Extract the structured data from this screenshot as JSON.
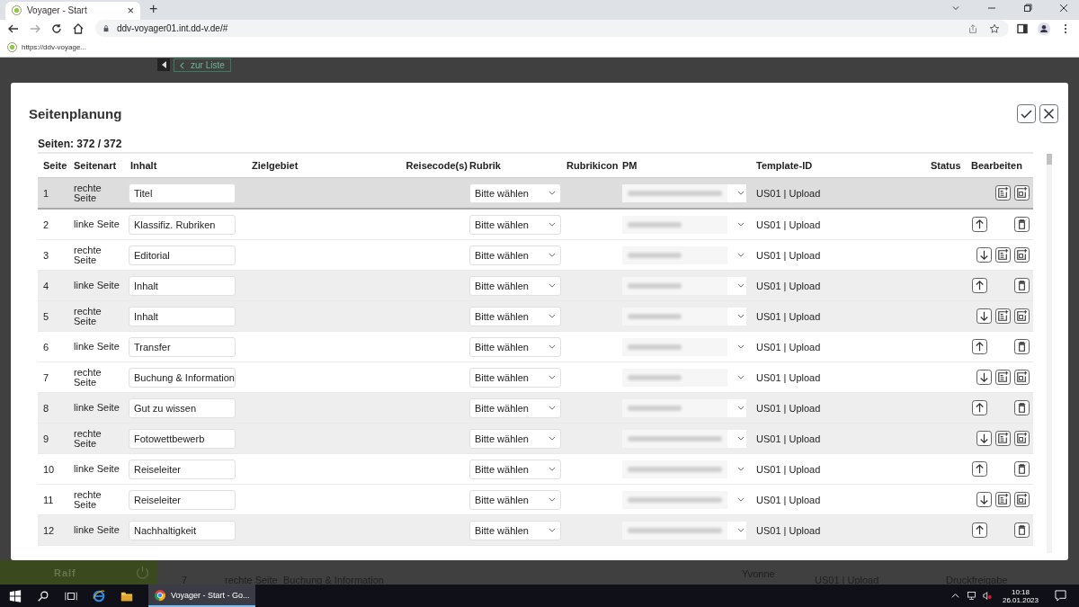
{
  "browser": {
    "tab_title": "Voyager - Start",
    "tab_close": "×",
    "new_tab": "+",
    "url": "ddv-voyager01.int.dd-v.de/#",
    "bookmark": "https://ddv-voyage..."
  },
  "background": {
    "back_button": "zur Liste",
    "user": "Ralf",
    "row": {
      "seite": "7",
      "seitenart": "rechte Seite",
      "inhalt": "Buchung & Information",
      "pm": "Yvonne",
      "template": "US01 | Upload",
      "status": "Druckfreigabe"
    }
  },
  "dialog": {
    "title": "Seitenplanung",
    "count": "Seiten: 372 / 372",
    "columns": [
      "Seite",
      "Seitenart",
      "Inhalt",
      "Zielgebiet",
      "Reisecode(s)",
      "Rubrik",
      "Rubrikicon",
      "PM",
      "Template-ID",
      "Status",
      "Bearbeiten"
    ],
    "rows": [
      {
        "seite": "1",
        "seitenart": "rechte Seite",
        "inhalt": "Titel",
        "rubrik": "Bitte wählen",
        "template": "US01 | Upload",
        "selected": true,
        "shaded": false,
        "actions": [
          {
            "kind": "add"
          },
          {
            "kind": "add-image"
          }
        ]
      },
      {
        "seite": "2",
        "seitenart": "linke Seite",
        "inhalt": "Klassifiz. Rubriken",
        "rubrik": "Bitte wählen",
        "template": "US01 | Upload",
        "selected": false,
        "shaded": false,
        "actions": [
          {
            "kind": "up"
          },
          {
            "kind": "delete"
          }
        ]
      },
      {
        "seite": "3",
        "seitenart": "rechte Seite",
        "inhalt": "Editorial",
        "rubrik": "Bitte wählen",
        "template": "US01 | Upload",
        "selected": false,
        "shaded": false,
        "actions": [
          {
            "kind": "down"
          },
          {
            "kind": "add"
          },
          {
            "kind": "add-image"
          }
        ]
      },
      {
        "seite": "4",
        "seitenart": "linke Seite",
        "inhalt": "Inhalt",
        "rubrik": "Bitte wählen",
        "template": "US01 | Upload",
        "selected": false,
        "shaded": true,
        "actions": [
          {
            "kind": "up"
          },
          {
            "kind": "delete"
          }
        ]
      },
      {
        "seite": "5",
        "seitenart": "rechte Seite",
        "inhalt": "Inhalt",
        "rubrik": "Bitte wählen",
        "template": "US01 | Upload",
        "selected": false,
        "shaded": true,
        "actions": [
          {
            "kind": "down"
          },
          {
            "kind": "add"
          },
          {
            "kind": "add-image"
          }
        ]
      },
      {
        "seite": "6",
        "seitenart": "linke Seite",
        "inhalt": "Transfer",
        "rubrik": "Bitte wählen",
        "template": "US01 | Upload",
        "selected": false,
        "shaded": false,
        "actions": [
          {
            "kind": "up"
          },
          {
            "kind": "delete"
          }
        ]
      },
      {
        "seite": "7",
        "seitenart": "rechte Seite",
        "inhalt": "Buchung & Information",
        "rubrik": "Bitte wählen",
        "template": "US01 | Upload",
        "selected": false,
        "shaded": false,
        "actions": [
          {
            "kind": "down"
          },
          {
            "kind": "add"
          },
          {
            "kind": "add-image"
          }
        ]
      },
      {
        "seite": "8",
        "seitenart": "linke Seite",
        "inhalt": "Gut zu wissen",
        "rubrik": "Bitte wählen",
        "template": "US01 | Upload",
        "selected": false,
        "shaded": true,
        "actions": [
          {
            "kind": "up"
          },
          {
            "kind": "delete"
          }
        ]
      },
      {
        "seite": "9",
        "seitenart": "rechte Seite",
        "inhalt": "Fotowettbewerb",
        "rubrik": "Bitte wählen",
        "template": "US01 | Upload",
        "selected": false,
        "shaded": true,
        "actions": [
          {
            "kind": "down"
          },
          {
            "kind": "add"
          },
          {
            "kind": "add-image"
          }
        ]
      },
      {
        "seite": "10",
        "seitenart": "linke Seite",
        "inhalt": "Reiseleiter",
        "rubrik": "Bitte wählen",
        "template": "US01 | Upload",
        "selected": false,
        "shaded": false,
        "actions": [
          {
            "kind": "up"
          },
          {
            "kind": "delete"
          }
        ]
      },
      {
        "seite": "11",
        "seitenart": "rechte Seite",
        "inhalt": "Reiseleiter",
        "rubrik": "Bitte wählen",
        "template": "US01 | Upload",
        "selected": false,
        "shaded": false,
        "actions": [
          {
            "kind": "down"
          },
          {
            "kind": "add"
          },
          {
            "kind": "add-image"
          }
        ]
      },
      {
        "seite": "12",
        "seitenart": "linke Seite",
        "inhalt": "Nachhaltigkeit",
        "rubrik": "Bitte wählen",
        "template": "US01 | Upload",
        "selected": false,
        "shaded": true,
        "actions": [
          {
            "kind": "up"
          },
          {
            "kind": "delete"
          }
        ]
      }
    ]
  },
  "taskbar": {
    "app": "Voyager - Start - Go...",
    "time": "10:18",
    "date": "26.01.2023"
  }
}
